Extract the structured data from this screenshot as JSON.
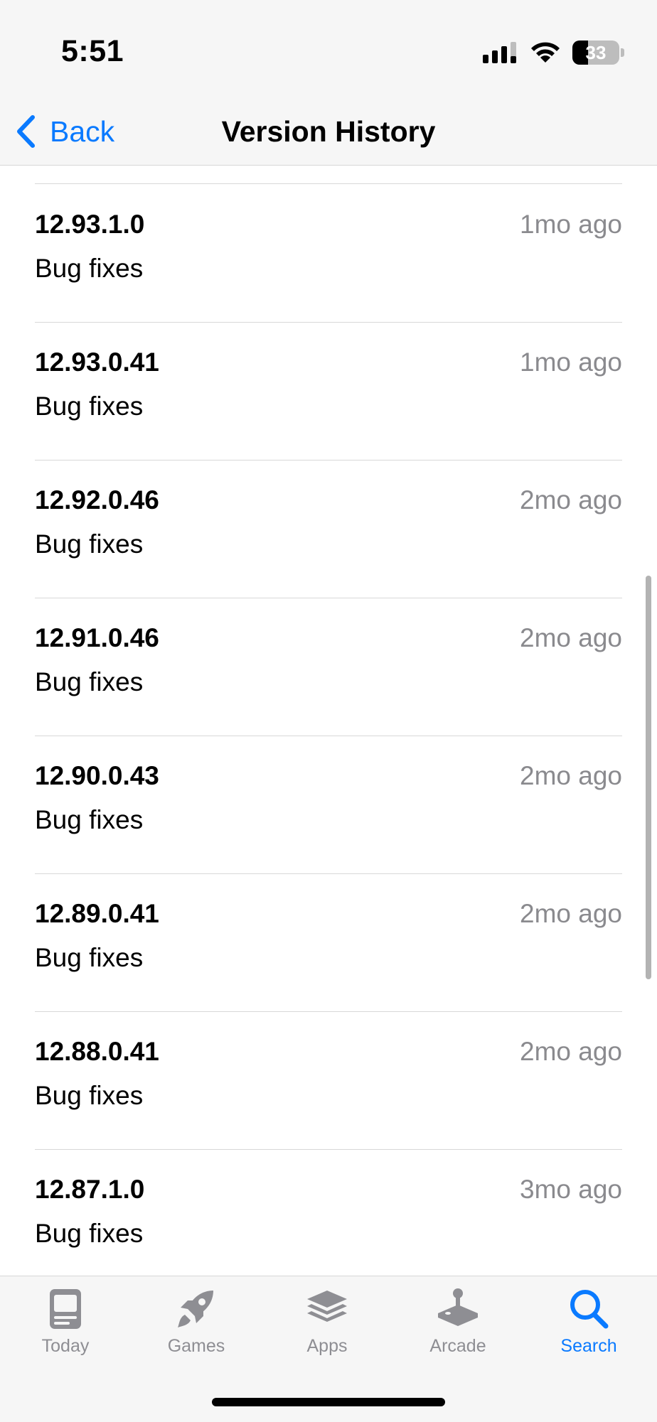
{
  "status_bar": {
    "time": "5:51",
    "battery_level": "33",
    "battery_fraction": 0.33,
    "signal_icon": "cellular-signal-icon",
    "wifi_icon": "wifi-icon"
  },
  "nav": {
    "back_label": "Back",
    "back_icon": "chevron-left-icon",
    "title": "Version History"
  },
  "versions": [
    {
      "version": "12.93.1.0",
      "age": "1mo ago",
      "notes": "Bug fixes"
    },
    {
      "version": "12.93.0.41",
      "age": "1mo ago",
      "notes": "Bug fixes"
    },
    {
      "version": "12.92.0.46",
      "age": "2mo ago",
      "notes": "Bug fixes"
    },
    {
      "version": "12.91.0.46",
      "age": "2mo ago",
      "notes": "Bug fixes"
    },
    {
      "version": "12.90.0.43",
      "age": "2mo ago",
      "notes": "Bug fixes"
    },
    {
      "version": "12.89.0.41",
      "age": "2mo ago",
      "notes": "Bug fixes"
    },
    {
      "version": "12.88.0.41",
      "age": "2mo ago",
      "notes": "Bug fixes"
    },
    {
      "version": "12.87.1.0",
      "age": "3mo ago",
      "notes": "Bug fixes"
    }
  ],
  "tab_bar": {
    "tabs": [
      {
        "label": "Today",
        "icon": "today-icon",
        "active": false
      },
      {
        "label": "Games",
        "icon": "rocket-icon",
        "active": false
      },
      {
        "label": "Apps",
        "icon": "apps-stack-icon",
        "active": false
      },
      {
        "label": "Arcade",
        "icon": "joystick-icon",
        "active": false
      },
      {
        "label": "Search",
        "icon": "search-icon",
        "active": true
      }
    ]
  },
  "colors": {
    "accent": "#0a7aff",
    "secondary_text": "#8a8a8e",
    "inactive_tab": "#8e8e93",
    "bar_background": "#f6f6f6"
  }
}
